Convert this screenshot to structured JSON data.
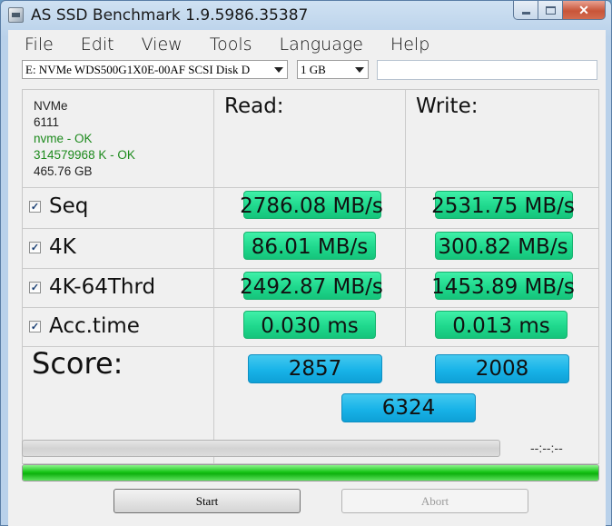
{
  "window": {
    "title": "AS SSD Benchmark 1.9.5986.35387",
    "controls": {
      "minimize_icon": "minimize-icon",
      "maximize_icon": "maximize-icon",
      "close_label": "✕"
    }
  },
  "menu": [
    "File",
    "Edit",
    "View",
    "Tools",
    "Language",
    "Help"
  ],
  "toolbar": {
    "drive_select": "E: NVMe WDS500G1X0E-00AF SCSI Disk D",
    "size_select": "1 GB",
    "text_field": ""
  },
  "drive_info": {
    "name": "NVMe",
    "firmware": "6111",
    "driver_status": "nvme - OK",
    "alignment_status": "314579968 K - OK",
    "capacity": "465.76 GB"
  },
  "columns": {
    "read": "Read:",
    "write": "Write:"
  },
  "rows": [
    {
      "label": "Seq",
      "checked": true,
      "read": "2786.08 MB/s",
      "write": "2531.75 MB/s"
    },
    {
      "label": "4K",
      "checked": true,
      "read": "86.01 MB/s",
      "write": "300.82 MB/s"
    },
    {
      "label": "4K-64Thrd",
      "checked": true,
      "read": "2492.87 MB/s",
      "write": "1453.89 MB/s"
    },
    {
      "label": "Acc.time",
      "checked": true,
      "read": "0.030 ms",
      "write": "0.013 ms"
    }
  ],
  "score": {
    "label": "Score:",
    "read": "2857",
    "write": "2008",
    "total": "6324"
  },
  "progress": {
    "current_fraction": 0.0,
    "elapsed": "--:--:--",
    "total_fraction": 1.0
  },
  "buttons": {
    "start": "Start",
    "abort": "Abort"
  },
  "colors": {
    "result_green": "#1fd88d",
    "score_blue": "#18b3e8",
    "ok_green": "#1d8a1d",
    "progress_green": "#16c416"
  },
  "icons": {
    "app": "as-ssd-app-icon",
    "check": "checkbox-checked-icon",
    "dropdown": "chevron-down-icon"
  }
}
